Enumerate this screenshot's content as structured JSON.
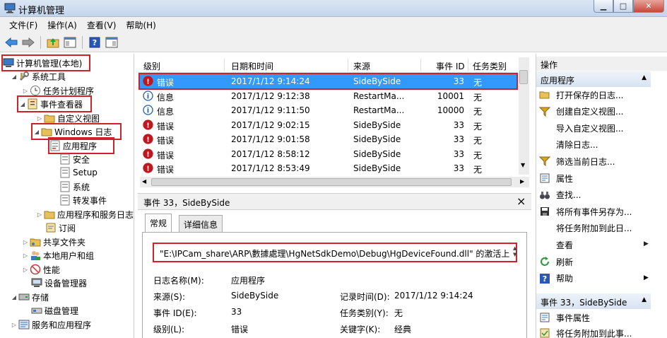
{
  "window": {
    "title": "计算机管理",
    "minimize": "▁",
    "maximize": "□",
    "close": "✕"
  },
  "menu": [
    "文件(F)",
    "操作(A)",
    "查看(V)",
    "帮助(H)"
  ],
  "tree": {
    "root": "计算机管理(本地)",
    "system_tools": "系统工具",
    "task_scheduler": "任务计划程序",
    "event_viewer": "事件查看器",
    "custom_views": "自定义视图",
    "windows_logs": "Windows 日志",
    "application": "应用程序",
    "security": "安全",
    "setup": "Setup",
    "system": "系统",
    "forwarded": "转发事件",
    "app_service_logs": "应用程序和服务日志",
    "subscriptions": "订阅",
    "shared_folders": "共享文件夹",
    "local_users": "本地用户和组",
    "performance": "性能",
    "device_manager": "设备管理器",
    "storage": "存储",
    "disk_management": "磁盘管理",
    "services_apps": "服务和应用程序"
  },
  "event_list": {
    "columns": [
      "级别",
      "日期和时间",
      "来源",
      "事件 ID",
      "任务类别"
    ],
    "rows": [
      {
        "level": "错误",
        "type": "error",
        "datetime": "2017/1/12 9:14:24",
        "source": "SideBySide",
        "id": "33",
        "category": "无"
      },
      {
        "level": "信息",
        "type": "info",
        "datetime": "2017/1/12 9:12:38",
        "source": "RestartMa...",
        "id": "10001",
        "category": "无"
      },
      {
        "level": "信息",
        "type": "info",
        "datetime": "2017/1/12 9:11:50",
        "source": "RestartMa...",
        "id": "10000",
        "category": "无"
      },
      {
        "level": "错误",
        "type": "error",
        "datetime": "2017/1/12 9:02:15",
        "source": "SideBySide",
        "id": "33",
        "category": "无"
      },
      {
        "level": "错误",
        "type": "error",
        "datetime": "2017/1/12 9:01:58",
        "source": "SideBySide",
        "id": "33",
        "category": "无"
      },
      {
        "level": "错误",
        "type": "error",
        "datetime": "2017/1/12 8:58:12",
        "source": "SideBySide",
        "id": "33",
        "category": "无"
      },
      {
        "level": "错误",
        "type": "error",
        "datetime": "2017/1/12 8:53:49",
        "source": "SideBySide",
        "id": "33",
        "category": "无"
      }
    ]
  },
  "detail": {
    "title": "事件 33，SideBySide",
    "close": "×",
    "tabs": [
      "常规",
      "详细信息"
    ],
    "message": "\"E:\\IPCam_share\\ARP\\數據處理\\HgNetSdkDemo\\Debug\\HgDeviceFound.dll\" 的激活上",
    "log_name_label": "日志名称(M):",
    "log_name": "应用程序",
    "source_label": "来源(S):",
    "source": "SideBySide",
    "logged_label": "记录时间(D):",
    "logged": "2017/1/12 9:14:24",
    "event_id_label": "事件 ID(E):",
    "event_id": "33",
    "task_label": "任务类别(Y):",
    "task": "无",
    "level_label": "级别(L):",
    "level": "错误",
    "keywords_label": "关键字(K):",
    "keywords": "经典"
  },
  "actions": {
    "header": "操作",
    "section1": "应用程序",
    "items1": [
      {
        "label": "打开保存的日志...",
        "icon": "folder-open-icon"
      },
      {
        "label": "创建自定义视图...",
        "icon": "filter-icon"
      },
      {
        "label": "导入自定义视图...",
        "icon": "none"
      },
      {
        "label": "清除日志...",
        "icon": "none"
      },
      {
        "label": "筛选当前日志...",
        "icon": "filter-icon"
      },
      {
        "label": "属性",
        "icon": "properties-icon"
      },
      {
        "label": "查找...",
        "icon": "binoculars-icon"
      },
      {
        "label": "将所有事件另存为...",
        "icon": "save-icon"
      },
      {
        "label": "将任务附加到此日...",
        "icon": "none"
      },
      {
        "label": "查看",
        "icon": "none"
      },
      {
        "label": "刷新",
        "icon": "refresh-icon"
      },
      {
        "label": "帮助",
        "icon": "help-icon"
      }
    ],
    "section2": "事件 33，SideBySide",
    "items2": [
      {
        "label": "事件属性",
        "icon": "properties-icon"
      },
      {
        "label": "将任务附加到此事...",
        "icon": "task-icon"
      }
    ]
  },
  "colors": {
    "selection": "#3399ff",
    "highlight_box": "#d0202a",
    "error": "#c0161d",
    "info": "#1f5fb8"
  }
}
